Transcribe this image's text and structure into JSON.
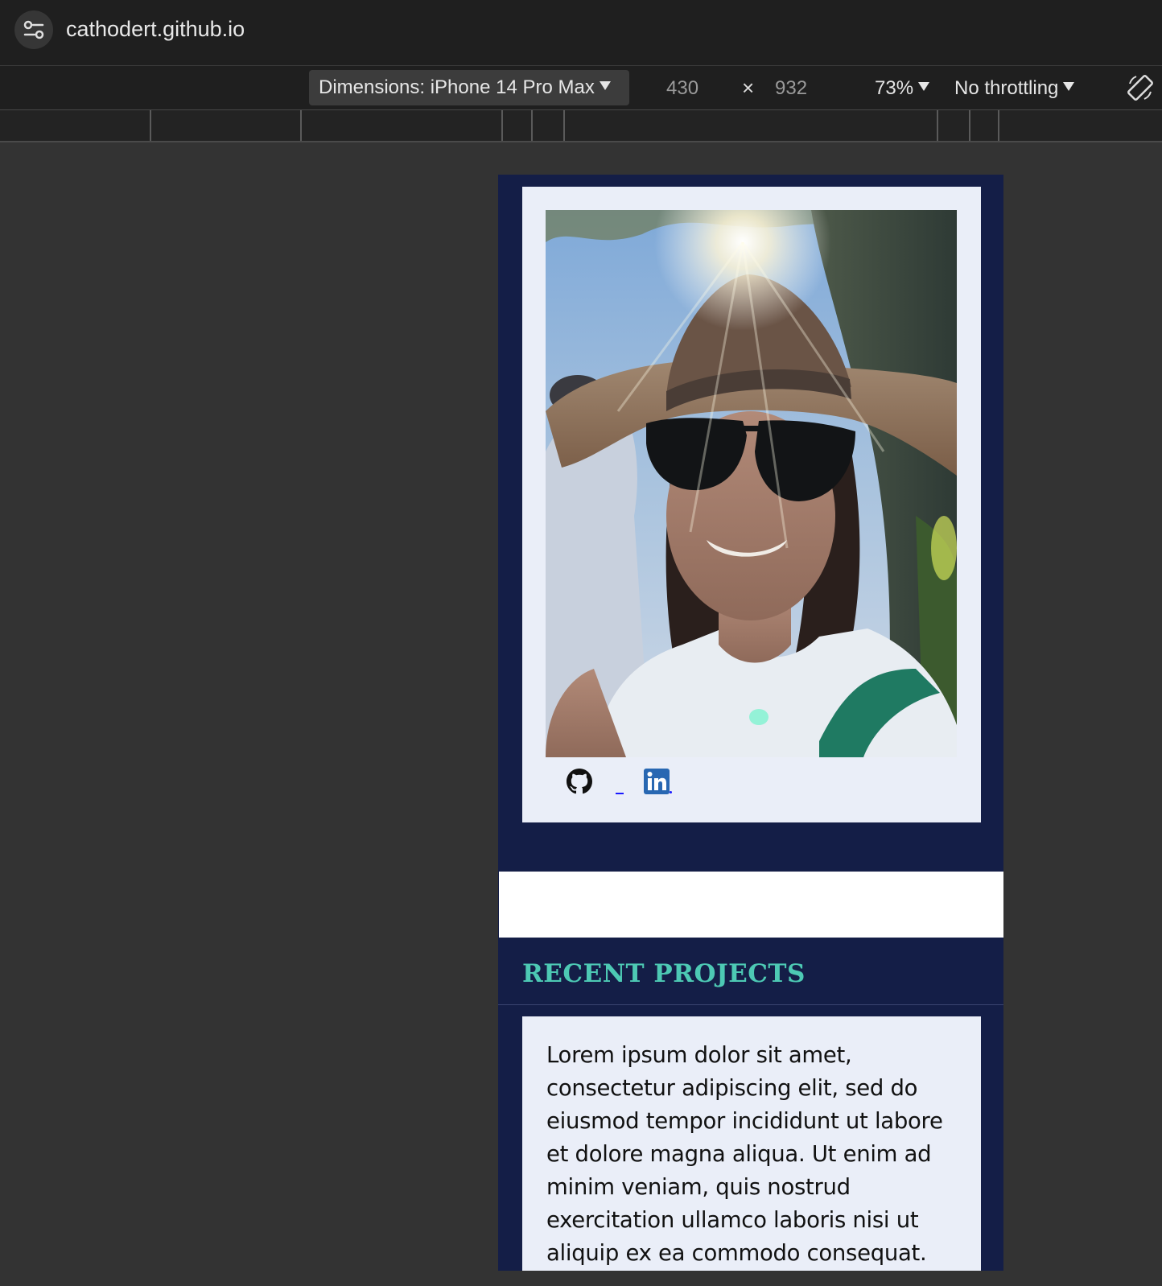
{
  "browser": {
    "url": "cathodert.github.io"
  },
  "device_toolbar": {
    "dimensions_label": "Dimensions: iPhone 14 Pro Max",
    "width": "430",
    "height": "932",
    "separator": "×",
    "zoom": "73%",
    "throttling": "No throttling"
  },
  "page": {
    "social": {
      "github_icon": "github-icon",
      "linkedin_icon": "linkedin-icon"
    },
    "section_title": "RECENT PROJECTS",
    "body_text": "Lorem ipsum dolor sit amet, consectetur adipiscing elit, sed do eiusmod tempor incididunt ut labore et dolore magna aliqua. Ut enim ad minim veniam, quis nostrud exercitation ullamco laboris nisi ut aliquip ex ea commodo consequat.",
    "colors": {
      "background": "#141e47",
      "card": "#eaeef8",
      "title_accent": "#4dc9b4",
      "linkedin": "#2867b2"
    }
  }
}
